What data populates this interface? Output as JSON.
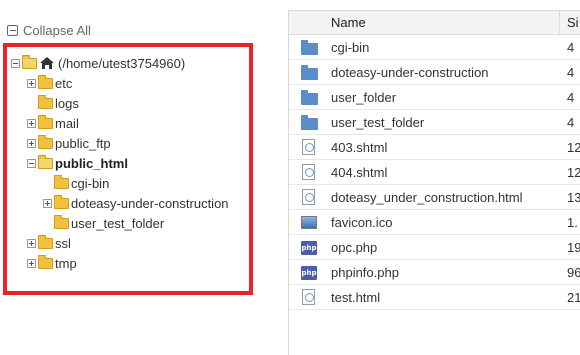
{
  "tree": {
    "collapse_all_label": "Collapse All",
    "root_label": "(/home/utest3754960)",
    "items": [
      {
        "label": "etc",
        "expander": "plus",
        "level": 1
      },
      {
        "label": "logs",
        "expander": "none",
        "level": 1
      },
      {
        "label": "mail",
        "expander": "plus",
        "level": 1
      },
      {
        "label": "public_ftp",
        "expander": "plus",
        "level": 1
      },
      {
        "label": "public_html",
        "expander": "minus",
        "level": 1,
        "selected": true
      },
      {
        "label": "cgi-bin",
        "expander": "none",
        "level": 2
      },
      {
        "label": "doteasy-under-construction",
        "expander": "plus",
        "level": 2
      },
      {
        "label": "user_test_folder",
        "expander": "none",
        "level": 2
      },
      {
        "label": "ssl",
        "expander": "plus",
        "level": 1
      },
      {
        "label": "tmp",
        "expander": "plus",
        "level": 1
      }
    ]
  },
  "file_list": {
    "columns": {
      "name": "Name",
      "size": "Si"
    },
    "rows": [
      {
        "name": "cgi-bin",
        "size": "4",
        "icon": "folder-icon"
      },
      {
        "name": "doteasy-under-construction",
        "size": "4",
        "icon": "folder-icon"
      },
      {
        "name": "user_folder",
        "size": "4",
        "icon": "folder-icon"
      },
      {
        "name": "user_test_folder",
        "size": "4",
        "icon": "folder-icon"
      },
      {
        "name": "403.shtml",
        "size": "12",
        "icon": "html-file-icon"
      },
      {
        "name": "404.shtml",
        "size": "12",
        "icon": "html-file-icon"
      },
      {
        "name": "doteasy_under_construction.html",
        "size": "13",
        "icon": "html-file-icon"
      },
      {
        "name": "favicon.ico",
        "size": "1.",
        "icon": "image-file-icon"
      },
      {
        "name": "opc.php",
        "size": "19",
        "icon": "php-file-icon"
      },
      {
        "name": "phpinfo.php",
        "size": "96",
        "icon": "php-file-icon"
      },
      {
        "name": "test.html",
        "size": "21",
        "icon": "html-file-icon"
      }
    ]
  },
  "colors": {
    "highlight_border": "#e8232b",
    "folder_yellow": "#f2c23f",
    "folder_blue": "#5b8dc9"
  }
}
